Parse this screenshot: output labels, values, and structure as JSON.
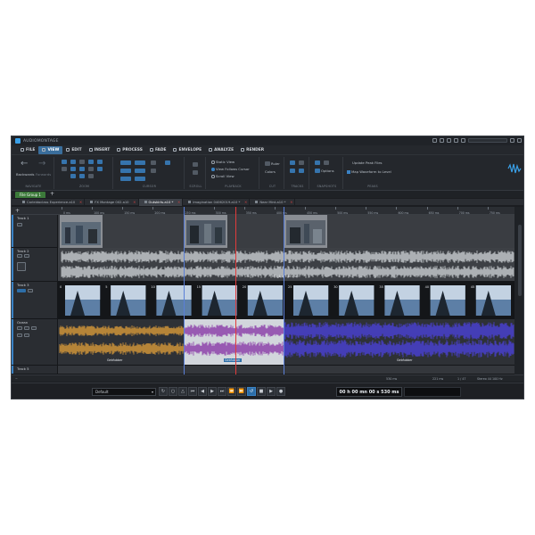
{
  "app": {
    "title": "AUDIOMONTAGE"
  },
  "menu": [
    {
      "label": "FILE"
    },
    {
      "label": "VIEW"
    },
    {
      "label": "EDIT"
    },
    {
      "label": "INSERT"
    },
    {
      "label": "PROCESS"
    },
    {
      "label": "FADE"
    },
    {
      "label": "ENVELOPE"
    },
    {
      "label": "ANALYZE"
    },
    {
      "label": "RENDER"
    }
  ],
  "ribbon": {
    "navigate": {
      "back": "Backwards",
      "forward": "Forwards",
      "group": "NAVIGATE"
    },
    "groups": {
      "zoom": "ZOOM",
      "cursor": "CURSOR",
      "scroll": "SCROLL",
      "playback": "PLAYBACK",
      "cut": "CUT",
      "tracks": "TRACKS",
      "snapshots": "SNAPSHOTS",
      "peaks": "PEAKS"
    },
    "playback_options": {
      "static": "Static View",
      "follows": "View Follows Cursor",
      "scroll": "Scroll View"
    },
    "ruler": "Ruler",
    "colors": "Colors",
    "options": "Options",
    "update_peak": "Update Peak Files",
    "map_waveform": "Map Waveform to Level"
  },
  "file_group": {
    "label": "File Group 1",
    "add": "+"
  },
  "doc_tabs": [
    {
      "label": "Carleidoclass Experience.a10"
    },
    {
      "label": "FX Montage 002.a10"
    },
    {
      "label": "Outskirts.a10 *"
    },
    {
      "label": "Imagination 04062019.a10 *"
    },
    {
      "label": "Near Mint.a10 *"
    }
  ],
  "ruler": {
    "add": "+",
    "ticks": [
      "0 ms",
      "100 ms",
      "150 ms",
      "200 ms",
      "250 ms",
      "300 ms",
      "350 ms",
      "400 ms",
      "450 ms",
      "500 ms",
      "550 ms",
      "600 ms",
      "650 ms",
      "700 ms",
      "750 ms"
    ]
  },
  "tracks": [
    {
      "name": "Track 1"
    },
    {
      "name": "Track 2"
    },
    {
      "name": "Track 3"
    },
    {
      "name": "Ocean"
    },
    {
      "name": "Track 5"
    }
  ],
  "clips": {
    "track2_label": "MIX_1501-44100",
    "ocean_left": "Gebfubber",
    "ocean_mid": "Gebfubber",
    "ocean_right": "Gebfubber",
    "frame_numbers": [
      "0",
      "5",
      "10",
      "15",
      "20",
      "25",
      "30",
      "35",
      "40",
      "45"
    ]
  },
  "status": {
    "zoom": "530 ms",
    "length": "221 ms",
    "pos": "1 / 47",
    "format": "Stereo 44 100 Hz"
  },
  "transport": {
    "preset": "Default",
    "time": "00 h 00 mn 00 s 530 ms"
  },
  "colors": {
    "accent": "#3a82c4",
    "cursor": "#e23b3b",
    "wave_gray": "#c9ccd0",
    "wave_orange": "#d89a3a",
    "wave_purple": "#8a3aa8",
    "wave_blue": "#4a42d8"
  }
}
